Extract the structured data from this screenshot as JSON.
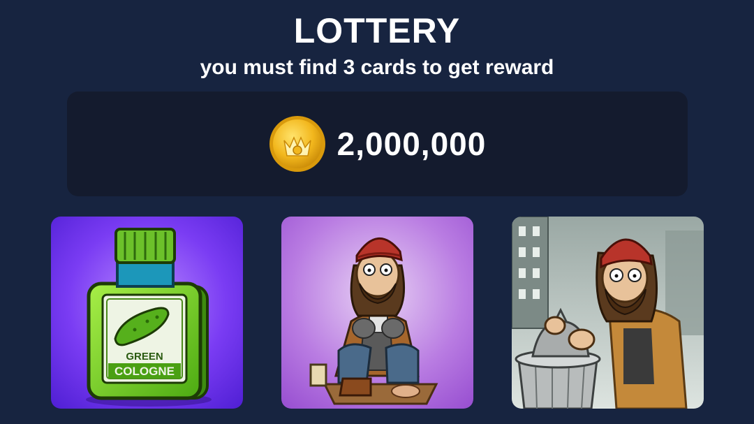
{
  "header": {
    "title": "LOTTERY",
    "subtitle": "you must find 3 cards to get reward"
  },
  "reward": {
    "icon": "gold-coin-icon",
    "amount": "2,000,000"
  },
  "cards": [
    {
      "name": "green-cologne",
      "label_line1": "GREEN",
      "label_line2": "COLOGNE",
      "background": "#6d2ff0"
    },
    {
      "name": "homeless-man-sitting-with-phone",
      "background": "#b27ae0"
    },
    {
      "name": "homeless-man-with-trash-can",
      "background": "#8a9a96"
    }
  ],
  "colors": {
    "background": "#172440",
    "panel": "#141b2e",
    "text": "#ffffff",
    "coin": "#f2b71d"
  }
}
